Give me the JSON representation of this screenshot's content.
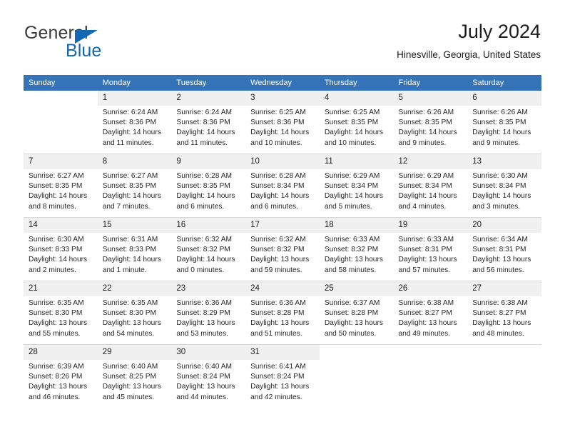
{
  "brand": {
    "word_one": "General",
    "word_two": "Blue",
    "logo_icon": "triangle-logo-icon"
  },
  "header": {
    "title": "July 2024",
    "subtitle": "Hinesville, Georgia, United States"
  },
  "colors": {
    "header_blue": "#3573b9",
    "brand_blue": "#1268b3",
    "daynum_shaded": "#f0f0f0",
    "grid_line": "#d8d8d8"
  },
  "calendar": {
    "weekdays": [
      "Sunday",
      "Monday",
      "Tuesday",
      "Wednesday",
      "Thursday",
      "Friday",
      "Saturday"
    ],
    "weeks": [
      [
        {
          "day": "",
          "sunrise": "",
          "sunset": "",
          "daylight_1": "",
          "daylight_2": ""
        },
        {
          "day": "1",
          "sunrise": "Sunrise: 6:24 AM",
          "sunset": "Sunset: 8:36 PM",
          "daylight_1": "Daylight: 14 hours",
          "daylight_2": "and 11 minutes."
        },
        {
          "day": "2",
          "sunrise": "Sunrise: 6:24 AM",
          "sunset": "Sunset: 8:36 PM",
          "daylight_1": "Daylight: 14 hours",
          "daylight_2": "and 11 minutes."
        },
        {
          "day": "3",
          "sunrise": "Sunrise: 6:25 AM",
          "sunset": "Sunset: 8:36 PM",
          "daylight_1": "Daylight: 14 hours",
          "daylight_2": "and 10 minutes."
        },
        {
          "day": "4",
          "sunrise": "Sunrise: 6:25 AM",
          "sunset": "Sunset: 8:35 PM",
          "daylight_1": "Daylight: 14 hours",
          "daylight_2": "and 10 minutes."
        },
        {
          "day": "5",
          "sunrise": "Sunrise: 6:26 AM",
          "sunset": "Sunset: 8:35 PM",
          "daylight_1": "Daylight: 14 hours",
          "daylight_2": "and 9 minutes."
        },
        {
          "day": "6",
          "sunrise": "Sunrise: 6:26 AM",
          "sunset": "Sunset: 8:35 PM",
          "daylight_1": "Daylight: 14 hours",
          "daylight_2": "and 9 minutes."
        }
      ],
      [
        {
          "day": "7",
          "sunrise": "Sunrise: 6:27 AM",
          "sunset": "Sunset: 8:35 PM",
          "daylight_1": "Daylight: 14 hours",
          "daylight_2": "and 8 minutes."
        },
        {
          "day": "8",
          "sunrise": "Sunrise: 6:27 AM",
          "sunset": "Sunset: 8:35 PM",
          "daylight_1": "Daylight: 14 hours",
          "daylight_2": "and 7 minutes."
        },
        {
          "day": "9",
          "sunrise": "Sunrise: 6:28 AM",
          "sunset": "Sunset: 8:35 PM",
          "daylight_1": "Daylight: 14 hours",
          "daylight_2": "and 6 minutes."
        },
        {
          "day": "10",
          "sunrise": "Sunrise: 6:28 AM",
          "sunset": "Sunset: 8:34 PM",
          "daylight_1": "Daylight: 14 hours",
          "daylight_2": "and 6 minutes."
        },
        {
          "day": "11",
          "sunrise": "Sunrise: 6:29 AM",
          "sunset": "Sunset: 8:34 PM",
          "daylight_1": "Daylight: 14 hours",
          "daylight_2": "and 5 minutes."
        },
        {
          "day": "12",
          "sunrise": "Sunrise: 6:29 AM",
          "sunset": "Sunset: 8:34 PM",
          "daylight_1": "Daylight: 14 hours",
          "daylight_2": "and 4 minutes."
        },
        {
          "day": "13",
          "sunrise": "Sunrise: 6:30 AM",
          "sunset": "Sunset: 8:34 PM",
          "daylight_1": "Daylight: 14 hours",
          "daylight_2": "and 3 minutes."
        }
      ],
      [
        {
          "day": "14",
          "sunrise": "Sunrise: 6:30 AM",
          "sunset": "Sunset: 8:33 PM",
          "daylight_1": "Daylight: 14 hours",
          "daylight_2": "and 2 minutes."
        },
        {
          "day": "15",
          "sunrise": "Sunrise: 6:31 AM",
          "sunset": "Sunset: 8:33 PM",
          "daylight_1": "Daylight: 14 hours",
          "daylight_2": "and 1 minute."
        },
        {
          "day": "16",
          "sunrise": "Sunrise: 6:32 AM",
          "sunset": "Sunset: 8:32 PM",
          "daylight_1": "Daylight: 14 hours",
          "daylight_2": "and 0 minutes."
        },
        {
          "day": "17",
          "sunrise": "Sunrise: 6:32 AM",
          "sunset": "Sunset: 8:32 PM",
          "daylight_1": "Daylight: 13 hours",
          "daylight_2": "and 59 minutes."
        },
        {
          "day": "18",
          "sunrise": "Sunrise: 6:33 AM",
          "sunset": "Sunset: 8:32 PM",
          "daylight_1": "Daylight: 13 hours",
          "daylight_2": "and 58 minutes."
        },
        {
          "day": "19",
          "sunrise": "Sunrise: 6:33 AM",
          "sunset": "Sunset: 8:31 PM",
          "daylight_1": "Daylight: 13 hours",
          "daylight_2": "and 57 minutes."
        },
        {
          "day": "20",
          "sunrise": "Sunrise: 6:34 AM",
          "sunset": "Sunset: 8:31 PM",
          "daylight_1": "Daylight: 13 hours",
          "daylight_2": "and 56 minutes."
        }
      ],
      [
        {
          "day": "21",
          "sunrise": "Sunrise: 6:35 AM",
          "sunset": "Sunset: 8:30 PM",
          "daylight_1": "Daylight: 13 hours",
          "daylight_2": "and 55 minutes."
        },
        {
          "day": "22",
          "sunrise": "Sunrise: 6:35 AM",
          "sunset": "Sunset: 8:30 PM",
          "daylight_1": "Daylight: 13 hours",
          "daylight_2": "and 54 minutes."
        },
        {
          "day": "23",
          "sunrise": "Sunrise: 6:36 AM",
          "sunset": "Sunset: 8:29 PM",
          "daylight_1": "Daylight: 13 hours",
          "daylight_2": "and 53 minutes."
        },
        {
          "day": "24",
          "sunrise": "Sunrise: 6:36 AM",
          "sunset": "Sunset: 8:28 PM",
          "daylight_1": "Daylight: 13 hours",
          "daylight_2": "and 51 minutes."
        },
        {
          "day": "25",
          "sunrise": "Sunrise: 6:37 AM",
          "sunset": "Sunset: 8:28 PM",
          "daylight_1": "Daylight: 13 hours",
          "daylight_2": "and 50 minutes."
        },
        {
          "day": "26",
          "sunrise": "Sunrise: 6:38 AM",
          "sunset": "Sunset: 8:27 PM",
          "daylight_1": "Daylight: 13 hours",
          "daylight_2": "and 49 minutes."
        },
        {
          "day": "27",
          "sunrise": "Sunrise: 6:38 AM",
          "sunset": "Sunset: 8:27 PM",
          "daylight_1": "Daylight: 13 hours",
          "daylight_2": "and 48 minutes."
        }
      ],
      [
        {
          "day": "28",
          "sunrise": "Sunrise: 6:39 AM",
          "sunset": "Sunset: 8:26 PM",
          "daylight_1": "Daylight: 13 hours",
          "daylight_2": "and 46 minutes."
        },
        {
          "day": "29",
          "sunrise": "Sunrise: 6:40 AM",
          "sunset": "Sunset: 8:25 PM",
          "daylight_1": "Daylight: 13 hours",
          "daylight_2": "and 45 minutes."
        },
        {
          "day": "30",
          "sunrise": "Sunrise: 6:40 AM",
          "sunset": "Sunset: 8:24 PM",
          "daylight_1": "Daylight: 13 hours",
          "daylight_2": "and 44 minutes."
        },
        {
          "day": "31",
          "sunrise": "Sunrise: 6:41 AM",
          "sunset": "Sunset: 8:24 PM",
          "daylight_1": "Daylight: 13 hours",
          "daylight_2": "and 42 minutes."
        },
        {
          "day": "",
          "sunrise": "",
          "sunset": "",
          "daylight_1": "",
          "daylight_2": ""
        },
        {
          "day": "",
          "sunrise": "",
          "sunset": "",
          "daylight_1": "",
          "daylight_2": ""
        },
        {
          "day": "",
          "sunrise": "",
          "sunset": "",
          "daylight_1": "",
          "daylight_2": ""
        }
      ]
    ]
  }
}
